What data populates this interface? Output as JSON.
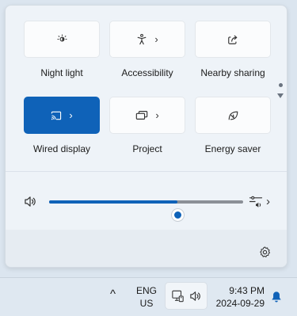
{
  "quick_settings": {
    "tiles": [
      {
        "name": "night-light",
        "label": "Night light",
        "active": false,
        "has_chevron": false,
        "icon": "night-light-icon"
      },
      {
        "name": "accessibility",
        "label": "Accessibility",
        "active": false,
        "has_chevron": true,
        "icon": "accessibility-icon"
      },
      {
        "name": "nearby-sharing",
        "label": "Nearby sharing",
        "active": false,
        "has_chevron": false,
        "icon": "share-icon"
      },
      {
        "name": "wired-display",
        "label": "Wired display",
        "active": true,
        "has_chevron": true,
        "icon": "cast-icon"
      },
      {
        "name": "project",
        "label": "Project",
        "active": false,
        "has_chevron": true,
        "icon": "project-icon"
      },
      {
        "name": "energy-saver",
        "label": "Energy saver",
        "active": false,
        "has_chevron": false,
        "icon": "leaf-icon"
      }
    ],
    "chevron_glyph": "›",
    "pager": {
      "pages": 2,
      "current": 1
    }
  },
  "volume": {
    "level_percent": 66,
    "icon": "speaker-icon",
    "output_icon": "audio-output-icon",
    "chevron_glyph": "›"
  },
  "footer": {
    "settings_icon": "gear-icon"
  },
  "taskbar": {
    "overflow_glyph": "^",
    "language_line1": "ENG",
    "language_line2": "US",
    "time": "9:43 PM",
    "date": "2024-09-29"
  },
  "colors": {
    "accent": "#0f62b8",
    "panel": "#eef3f8",
    "tile": "#fbfcfd"
  }
}
